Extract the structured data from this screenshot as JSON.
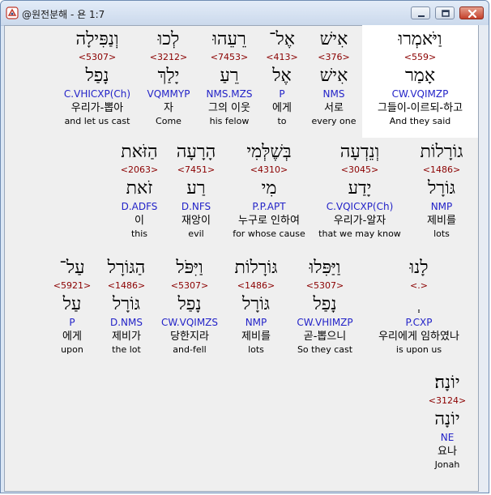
{
  "window": {
    "title": "@원전분해 - 욘 1:7",
    "minimize_label": "",
    "maximize_label": "",
    "close_label": ""
  },
  "words": [
    {
      "heb": "וַיֹּאמְרוּ",
      "num": "<559>",
      "lemma": "אָמַר",
      "parse": "CW.VQIMZP",
      "kor": "그들이-이르되-하고",
      "eng": "And they said",
      "selected": true
    },
    {
      "heb": "אִישׁ",
      "num": "<376>",
      "lemma": "אִישׁ",
      "parse": "NMS",
      "kor": "서로",
      "eng": "every one"
    },
    {
      "heb": "אֶל־",
      "num": "<413>",
      "lemma": "אֶל",
      "parse": "P",
      "kor": "에게",
      "eng": "to"
    },
    {
      "heb": "רֵעֵהוּ",
      "num": "<7453>",
      "lemma": "רֵעַ",
      "parse": "NMS.MZS",
      "kor": "그의 이웃",
      "eng": "his felow"
    },
    {
      "heb": "לְכוּ",
      "num": "<3212>",
      "lemma": "יָלַךְ",
      "parse": "VQMMYP",
      "kor": "자",
      "eng": "Come"
    },
    {
      "heb": "וְנַפִּילָה",
      "num": "<5307>",
      "lemma": "נָפַל",
      "parse": "C.VHICXP(Ch)",
      "kor": "우리가-뽑아",
      "eng": "and let us cast"
    },
    {
      "heb": "גוֹרָלוֹת",
      "num": "<1486>",
      "lemma": "גּוֹרָל",
      "parse": "NMP",
      "kor": "제비를",
      "eng": "lots"
    },
    {
      "heb": "וְנֵדְעָה",
      "num": "<3045>",
      "lemma": "יָדַע",
      "parse": "C.VQICXP(Ch)",
      "kor": "우리가-알자",
      "eng": "that we may know"
    },
    {
      "heb": "בְּשֶׁלְּמִי",
      "num": "<4310>",
      "lemma": "מִי",
      "parse": "P.P.APT",
      "kor": "누구로 인하여",
      "eng": "for whose cause"
    },
    {
      "heb": "הָרָעָה",
      "num": "<7451>",
      "lemma": "רַע",
      "parse": "D.NFS",
      "kor": "재앙이",
      "eng": "evil"
    },
    {
      "heb": "הַזֹּאת",
      "num": "<2063>",
      "lemma": "זֹאת",
      "parse": "D.ADFS",
      "kor": "이",
      "eng": "this"
    },
    {
      "heb": "לָנוּ",
      "num": "<.>",
      "lemma": "ְ",
      "parse": "P.CXP",
      "kor": "우리에게 임하였나",
      "eng": "is upon us"
    },
    {
      "heb": "וַיַּפִּלוּ",
      "num": "<5307>",
      "lemma": "נָפַל",
      "parse": "CW.VHIMZP",
      "kor": "곧-뽑으니",
      "eng": "So they cast"
    },
    {
      "heb": "גּוֹרָלוֹת",
      "num": "<1486>",
      "lemma": "גּוֹרָל",
      "parse": "NMP",
      "kor": "제비를",
      "eng": "lots"
    },
    {
      "heb": "וַיִּפֹּל",
      "num": "<5307>",
      "lemma": "נָפַל",
      "parse": "CW.VQIMZS",
      "kor": "당한지라",
      "eng": "and-fell"
    },
    {
      "heb": "הַגּוֹרָל",
      "num": "<1486>",
      "lemma": "גּוֹרָל",
      "parse": "D.NMS",
      "kor": "제비가",
      "eng": "the lot"
    },
    {
      "heb": "עַל־",
      "num": "<5921>",
      "lemma": "עַל",
      "parse": "P",
      "kor": "에게",
      "eng": "upon"
    },
    {
      "heb": "יוֹנָה׃",
      "num": "<3124>",
      "lemma": "יוֹנָה",
      "parse": "NE",
      "kor": "요나",
      "eng": "Jonah"
    }
  ]
}
